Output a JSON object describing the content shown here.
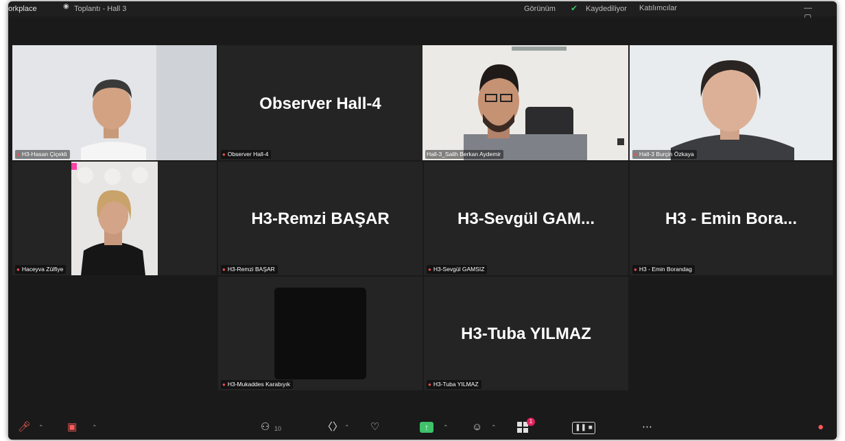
{
  "titlebar": {
    "app_name": "orkplace",
    "meeting_label": "Toplantı - Hall 3",
    "view_label": "Görünüm",
    "recording_label": "Kaydediliyor",
    "misc_label": "Katılımcılar",
    "window_controls": "— ▢ ✕"
  },
  "tiles": [
    {
      "id": "hasan",
      "name_tag": "H3-Hasan Çiçekli",
      "type": "video",
      "active": false
    },
    {
      "id": "observer",
      "display_name": "Observer Hall-4",
      "name_tag": "Observer Hall-4",
      "type": "name",
      "active": false
    },
    {
      "id": "salih",
      "name_tag": "Hall-3_Salih Berkan Aydemir",
      "type": "video",
      "active": true
    },
    {
      "id": "burcin",
      "name_tag": "Hall-3 Burçin Özkaya",
      "type": "video",
      "active": false
    },
    {
      "id": "hacer",
      "name_tag": "Haceyva Zülfiye",
      "type": "video",
      "active": false
    },
    {
      "id": "remzi",
      "display_name": "H3-Remzi BAŞAR",
      "name_tag": "H3-Remzi BAŞAR",
      "type": "name",
      "active": false
    },
    {
      "id": "sevgul",
      "display_name": "H3-Sevgül  GAM...",
      "name_tag": "H3-Sevgül GAMSIZ",
      "type": "name",
      "active": false
    },
    {
      "id": "emin",
      "display_name": "H3  -  Emin Bora...",
      "name_tag": "H3 - Emin Borandag",
      "type": "name",
      "active": false
    },
    {
      "id": "mukaddes",
      "name_tag": "H3-Mukaddes Karabıyık",
      "type": "blank",
      "active": false
    },
    {
      "id": "tuba",
      "display_name": "H3-Tuba YILMAZ",
      "name_tag": "H3-Tuba YILMAZ",
      "type": "name",
      "active": false
    }
  ],
  "toolbar": {
    "icons": [
      "mic-muted-icon",
      "camera-off-icon",
      "participants-icon",
      "chat-icon",
      "heart-icon",
      "share-screen-icon",
      "reactions-icon",
      "apps-icon",
      "pause-record-icon",
      "more-icon",
      "leave-icon"
    ],
    "participants_count": "10",
    "apps_badge": "1"
  },
  "colors": {
    "background": "#1a1a1a",
    "tile": "#242424",
    "active_speaker": "#27d06a",
    "muted_mic": "#ff4b4b",
    "share": "#3fc26a"
  }
}
